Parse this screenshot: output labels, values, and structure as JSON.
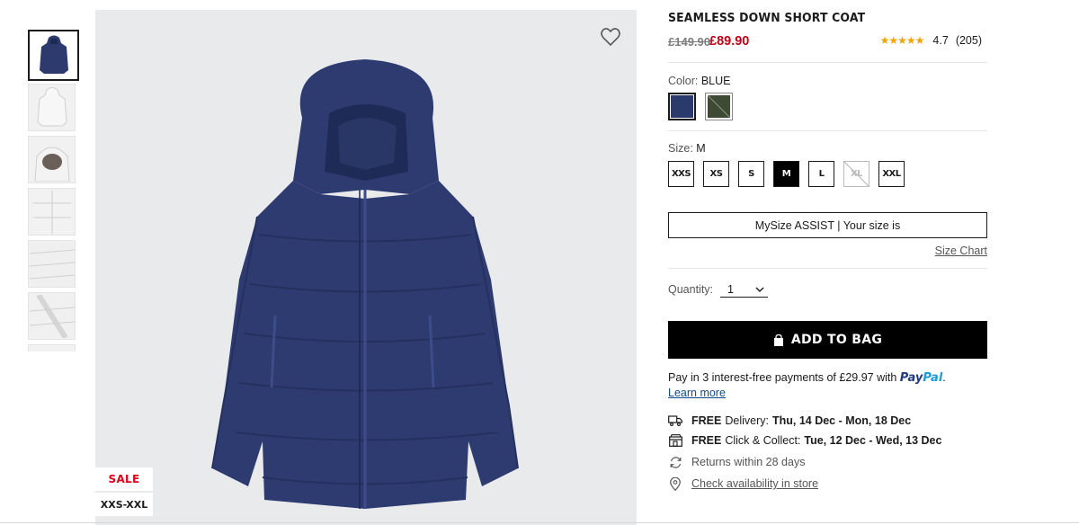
{
  "product": {
    "title": "SEAMLESS DOWN SHORT COAT",
    "old_price": "£149.90",
    "new_price": "£89.90",
    "rating_stars": "★★★★★",
    "rating_value": "4.7",
    "review_count": "(205)",
    "badges": {
      "sale": "SALE",
      "size_range": "XXS-XXL"
    }
  },
  "thumbnails": [
    {
      "name": "thumb-blue-coat",
      "color": "#2c3a6e",
      "active": true
    },
    {
      "name": "thumb-white-coat-back",
      "color": "#e6e6e6",
      "active": false
    },
    {
      "name": "thumb-white-hood-detail",
      "color": "#dcdcdc",
      "active": false
    },
    {
      "name": "thumb-white-coat-detail",
      "color": "#e4e4e4",
      "active": false
    },
    {
      "name": "thumb-white-quilting",
      "color": "#e2e2e2",
      "active": false
    },
    {
      "name": "thumb-white-sleeve",
      "color": "#e5e5e5",
      "active": false
    }
  ],
  "color": {
    "label": "Color:",
    "selected": "BLUE",
    "swatches": [
      {
        "name": "blue",
        "hex": "#2b3a6c",
        "active": true
      },
      {
        "name": "olive",
        "hex": "#3e4a33",
        "active": false
      }
    ]
  },
  "size": {
    "label": "Size:",
    "selected": "M",
    "options": [
      {
        "label": "XXS",
        "state": "available"
      },
      {
        "label": "XS",
        "state": "available"
      },
      {
        "label": "S",
        "state": "available"
      },
      {
        "label": "M",
        "state": "selected"
      },
      {
        "label": "L",
        "state": "available"
      },
      {
        "label": "XL",
        "state": "unavailable"
      },
      {
        "label": "XXL",
        "state": "available"
      }
    ],
    "mysize_assist": "MySize ASSIST | Your size is",
    "size_chart": "Size Chart"
  },
  "quantity": {
    "label": "Quantity:",
    "value": "1"
  },
  "add_to_bag": "ADD TO BAG",
  "payment": {
    "text": "Pay in 3 interest-free payments of £29.97 with",
    "paypal_a": "Pay",
    "paypal_b": "Pal",
    "period": ".",
    "learn_more": "Learn more"
  },
  "delivery": {
    "free_label": "FREE",
    "delivery_text": "Delivery:",
    "delivery_dates": "Thu, 14 Dec - Mon, 18 Dec",
    "collect_text": "Click & Collect:",
    "collect_dates": "Tue, 12 Dec - Wed, 13 Dec",
    "returns": "Returns within 28 days",
    "availability": "Check availability in store"
  },
  "colors": {
    "price_sale": "#c40018",
    "stars": "#f0a500",
    "background_image": "#e9eaec"
  }
}
